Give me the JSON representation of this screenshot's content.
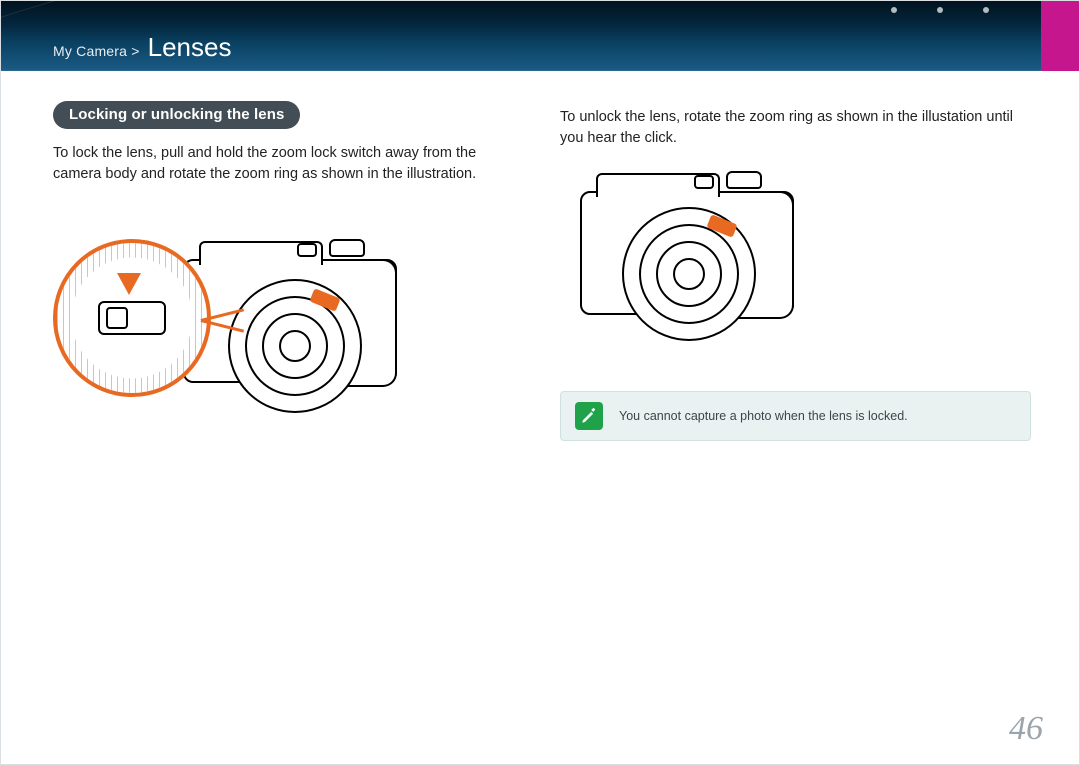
{
  "header": {
    "breadcrumb_path": "My Camera >",
    "breadcrumb_current": "Lenses"
  },
  "section_title": "Locking or unlocking the lens",
  "left_paragraph": "To lock the lens, pull and hold the zoom lock switch away from the camera body and rotate the zoom ring as shown in the illustration.",
  "right_paragraph": "To unlock the lens, rotate the zoom ring as shown in the illustation until you hear the click.",
  "note_text": "You cannot capture a photo when the lens is locked.",
  "page_number": "46",
  "icons": {
    "note": "pen-icon",
    "callout_arrow": "down-arrow-icon"
  }
}
